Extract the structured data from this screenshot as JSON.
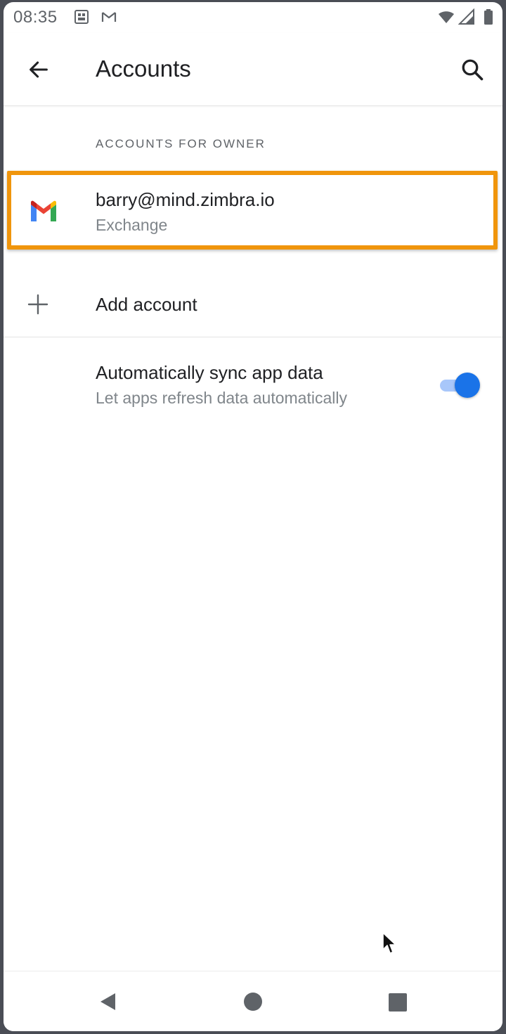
{
  "status_bar": {
    "time": "08:35",
    "icons": [
      "photo-notification-icon",
      "gmail-notification-icon",
      "wifi-icon",
      "signal-icon",
      "battery-icon"
    ]
  },
  "app_bar": {
    "title": "Accounts",
    "back_icon": "arrow-left-icon",
    "search_icon": "search-icon"
  },
  "section": {
    "header": "ACCOUNTS FOR OWNER"
  },
  "accounts": [
    {
      "email": "barry@mind.zimbra.io",
      "type": "Exchange",
      "icon": "gmail-logo"
    }
  ],
  "add_account": {
    "label": "Add account",
    "icon": "plus-icon"
  },
  "sync": {
    "title": "Automatically sync app data",
    "subtitle": "Let apps refresh data automatically",
    "enabled": true
  },
  "colors": {
    "highlight": "#f0950c",
    "toggle_on": "#1a73e8",
    "toggle_track": "#a8c7fa",
    "primary_text": "#202124",
    "secondary_text": "#80868b"
  },
  "nav_bar": {
    "icons": [
      "nav-back-icon",
      "nav-home-icon",
      "nav-recents-icon"
    ]
  }
}
